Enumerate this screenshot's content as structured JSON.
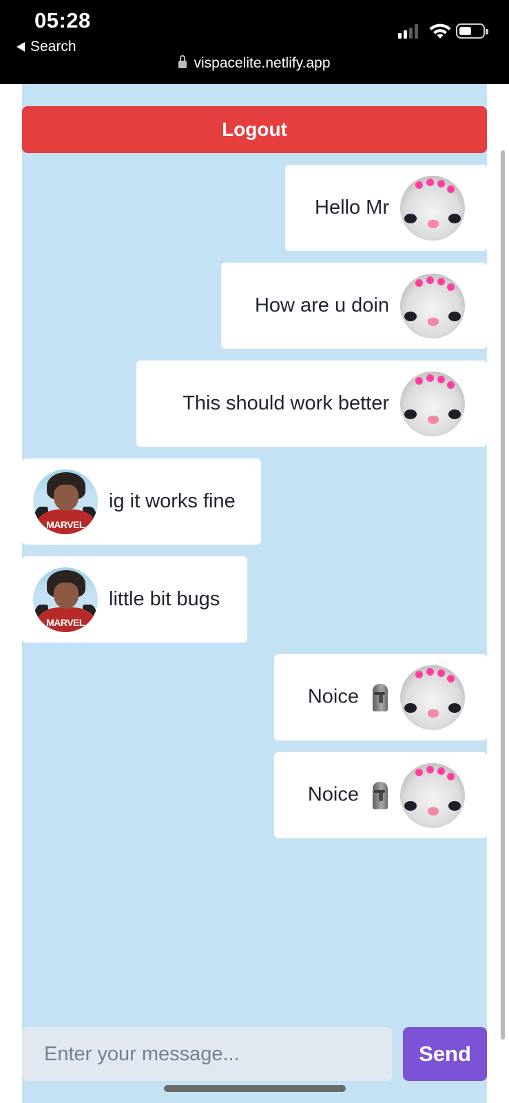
{
  "status_bar": {
    "time": "05:28",
    "back_label": "Search",
    "url": "vispacelite.netlify.app",
    "icons": [
      "signal-icon",
      "wifi-icon",
      "battery-icon",
      "lock-icon"
    ]
  },
  "logout_label": "Logout",
  "messages": [
    {
      "text": "Hello Mr",
      "side": "right",
      "avatar": "cat-avatar"
    },
    {
      "text": "How are u doin",
      "side": "right",
      "avatar": "cat-avatar"
    },
    {
      "text": "This should work better",
      "side": "right",
      "avatar": "cat-avatar"
    },
    {
      "text": "ig it works fine",
      "side": "left",
      "avatar": "marvel-avatar"
    },
    {
      "text": "little bit bugs",
      "side": "left",
      "avatar": "marvel-avatar"
    },
    {
      "text": "Noice",
      "emoji": "moai-emoji",
      "side": "right",
      "avatar": "cat-avatar"
    },
    {
      "text": "Noice",
      "emoji": "moai-emoji",
      "side": "right",
      "avatar": "cat-avatar"
    }
  ],
  "avatar_logo_text": "MARVEL",
  "composer": {
    "placeholder": "Enter your message...",
    "value": "",
    "send_label": "Send"
  },
  "colors": {
    "chat_background": "#c4e2f3",
    "logout": "#e53e3e",
    "send": "#7c52d6",
    "input_background": "#e2e8f0"
  }
}
